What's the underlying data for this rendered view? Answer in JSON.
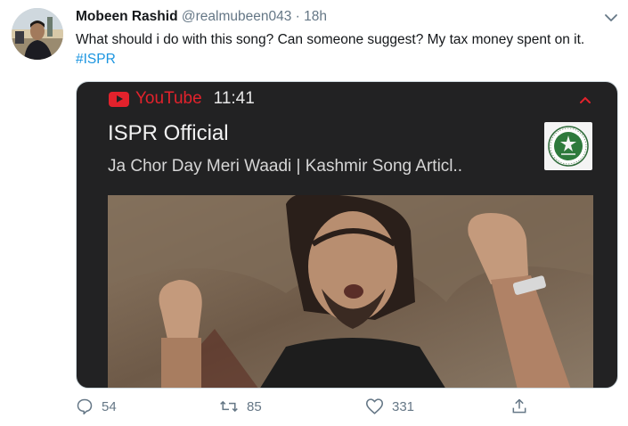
{
  "tweet": {
    "author_name": "Mobeen Rashid",
    "handle": "@realmubeen043",
    "separator": "·",
    "time": "18h",
    "text_before": "What should i do with this song? Can someone suggest? My tax money spent on it. ",
    "hashtag": "#ISPR"
  },
  "media": {
    "source": "YouTube",
    "clock": "11:41",
    "channel": "ISPR Official",
    "video_title": "Ja Chor Day Meri Waadi | Kashmir Song Articl.."
  },
  "actions": {
    "replies": "54",
    "retweets": "85",
    "likes": "331"
  },
  "colors": {
    "accent": "#1b95e0",
    "youtube_red": "#e3222c",
    "card_bg": "#222223",
    "muted": "#657786"
  },
  "icons": [
    "chevron-down-icon",
    "youtube-icon",
    "chevron-up-icon",
    "ispr-emblem-icon",
    "reply-icon",
    "retweet-icon",
    "like-icon",
    "share-icon"
  ]
}
